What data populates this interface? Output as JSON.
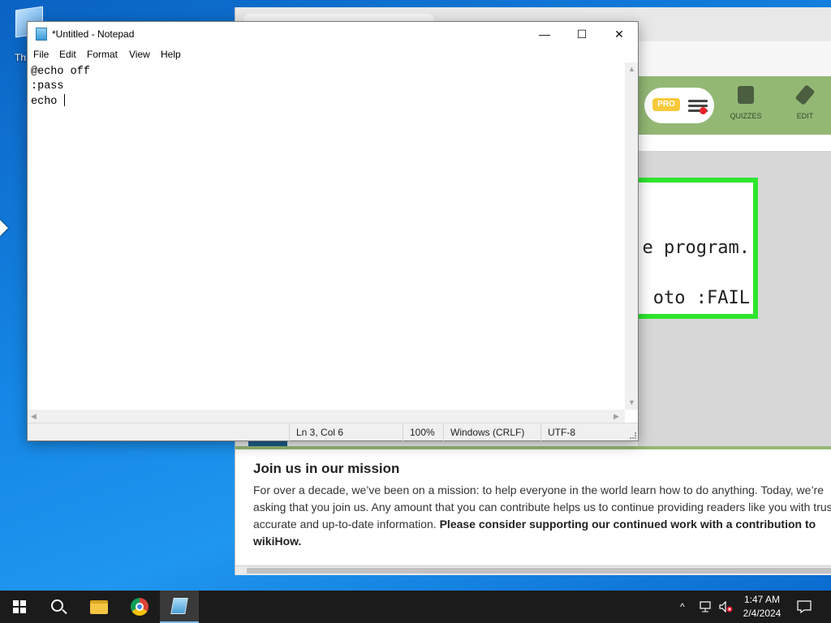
{
  "desktop": {
    "icon_label": "Th"
  },
  "browser": {
    "header": {
      "pro_badge": "PRO",
      "nav": [
        {
          "label": "QUIZZES"
        },
        {
          "label": "EDIT"
        }
      ]
    },
    "code_lines": [
      "e program.",
      "oto :FAIL"
    ],
    "mission": {
      "title": "Join us in our mission",
      "body": "For over a decade, we’ve been on a mission: to help everyone in the world learn how to do anything. Today, we’re asking that you join us. Any amount that you can contribute helps us to continue providing readers like you with trusted, accurate and up-to-date information.",
      "bold": "Please consider supporting our continued work with a contribution to wikiHow."
    }
  },
  "notepad": {
    "title": "*Untitled - Notepad",
    "window_buttons": {
      "minimize": "—",
      "maximize": "☐",
      "close": "✕"
    },
    "menu": [
      "File",
      "Edit",
      "Format",
      "View",
      "Help"
    ],
    "lines": [
      "@echo off",
      ":pass",
      "echo "
    ],
    "status": {
      "position": "Ln 3, Col 6",
      "zoom": "100%",
      "line_ending": "Windows (CRLF)",
      "encoding": "UTF-8"
    }
  },
  "taskbar": {
    "apps": [
      "start",
      "search",
      "file-explorer",
      "chrome",
      "notepad"
    ],
    "tray": {
      "chevron": "^"
    },
    "clock": {
      "time": "1:47 AM",
      "date": "2/4/2024"
    }
  }
}
